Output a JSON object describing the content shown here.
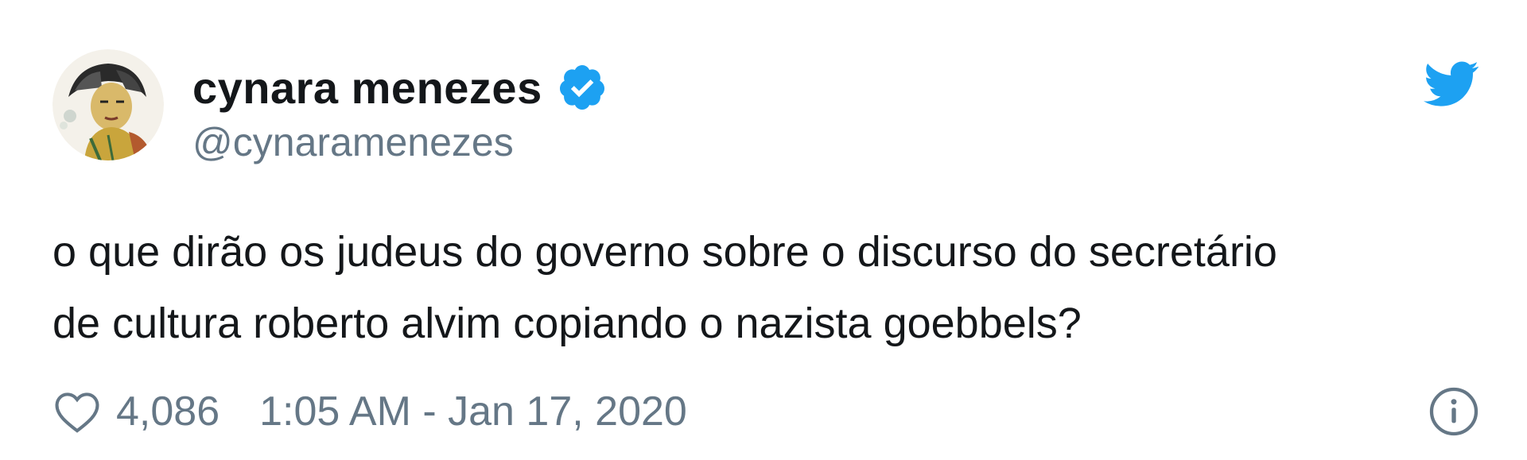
{
  "user": {
    "display_name": "cynara menezes",
    "handle": "@cynaramenezes",
    "verified_icon": "verified-badge-icon",
    "avatar_icon": "avatar-illustration"
  },
  "tweet": {
    "lines": [
      "o que dirão os judeus do governo sobre o discurso do secretário",
      "de cultura roberto alvim copiando o nazista goebbels?"
    ]
  },
  "footer": {
    "likes": "4,086",
    "timestamp": "1:05 AM - Jan 17, 2020"
  },
  "icons": {
    "brand": "twitter-bird-icon",
    "like": "heart-icon",
    "info": "info-icon"
  },
  "colors": {
    "brand_blue": "#1da1f2",
    "text_primary": "#14171a",
    "text_secondary": "#657786"
  }
}
